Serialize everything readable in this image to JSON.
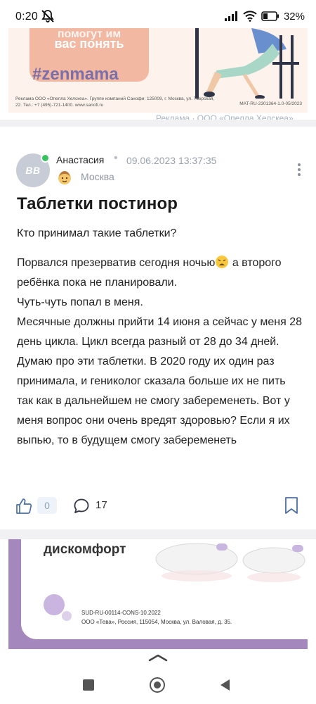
{
  "status_bar": {
    "time": "0:20",
    "battery_percent": "32%"
  },
  "top_ad": {
    "cta_line1": "помогут им",
    "cta_line2": "вас понять",
    "hashtag": "#zenmama",
    "legal": "Реклама ООО «Опелла Хелскеа». Группе компаний Санофи: 125009, г. Москва, ул. Тверская, 22. Тел.: +7 (495)-721-1400. www.sanofi.ru",
    "code": "MAT-RU-2301364-1.0-05/2023",
    "footer": "Реклама · ООО «Опелла Хелскеа»"
  },
  "post": {
    "avatar_initials": "ВВ",
    "author": "Анастасия",
    "separator": "•",
    "date": "09.06.2023 13:37:35",
    "city": "Москва",
    "title": "Таблетки постинор",
    "question": "Кто принимал такие таблетки?",
    "body": [
      "Порвался презерватив сегодня ночью",
      " а второго ребёнка пока не планировали.",
      "Чуть-чуть попал в меня.",
      "Месячные должны прийти 14 июня а сейчас у меня 28 день цикла. Цикл всегда разный от 28 до 34 дней.",
      "Думаю про эти таблетки. В 2020 году их один раз принимала, и гениколог сказала больше их не пить так как в дальнейшем не смогу забеременеть. Вот у меня вопрос они очень вредят здоровью? Если я их выпью, то в будущем смогу забеременеть"
    ],
    "likes": "0",
    "comments": "17",
    "icons": {
      "more": "more-vertical-icon",
      "like": "thumbs-up-icon",
      "comment": "comment-icon",
      "bookmark": "bookmark-icon",
      "city_emoji": "face-emoji-icon",
      "body_emoji": "weary-face-emoji"
    }
  },
  "bottom_ad": {
    "headline": "дискомфорт",
    "legal_line1": "SUD-RU-00114-CONS-10.2022",
    "legal_line2": "ООО «Тева», Россия, 115054, Москва, ул. Валовая, д. 35."
  },
  "colors": {
    "accent_purple": "#a487bd",
    "online": "#37c25d",
    "like_bg": "#eef3f9",
    "ad_top_bg": "#fdf3ec"
  }
}
